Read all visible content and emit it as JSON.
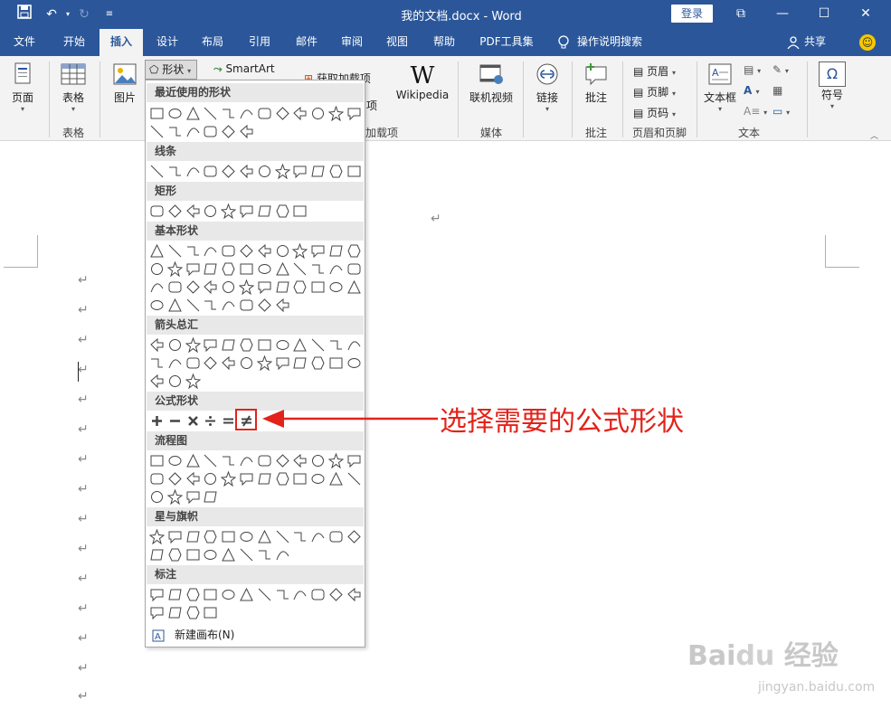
{
  "titlebar": {
    "title": "我的文档.docx  -  Word",
    "login": "登录",
    "bg": "#2b579a"
  },
  "tabs": [
    {
      "label": "文件",
      "active": false
    },
    {
      "label": "开始",
      "active": false
    },
    {
      "label": "插入",
      "active": true
    },
    {
      "label": "设计",
      "active": false
    },
    {
      "label": "布局",
      "active": false
    },
    {
      "label": "引用",
      "active": false
    },
    {
      "label": "邮件",
      "active": false
    },
    {
      "label": "审阅",
      "active": false
    },
    {
      "label": "视图",
      "active": false
    },
    {
      "label": "帮助",
      "active": false
    },
    {
      "label": "PDF工具集",
      "active": false
    }
  ],
  "tellme": "操作说明搜索",
  "share": "共享",
  "ribbon": {
    "page": "页面",
    "table": "表格",
    "table_group": "表格",
    "pictures": "图片",
    "shapes": "形状",
    "smartart": "SmartArt",
    "get_addins": "获取加载项",
    "addins_partial": "项",
    "addins_group_partial": "加载项",
    "wikipedia": "Wikipedia",
    "online_video": "联机视频",
    "media_group": "媒体",
    "link": "链接",
    "comment": "批注",
    "comment_group": "批注",
    "header": "页眉",
    "footer": "页脚",
    "page_number": "页码",
    "header_footer_group": "页眉和页脚",
    "textbox": "文本框",
    "text_group": "文本",
    "symbol": "符号"
  },
  "dropdown": {
    "sections": {
      "recent": "最近使用的形状",
      "lines": "线条",
      "rect": "矩形",
      "basic": "基本形状",
      "arrows": "箭头总汇",
      "equation": "公式形状",
      "flowchart": "流程图",
      "stars": "星与旗帜",
      "callouts": "标注"
    },
    "new_canvas": "新建画布(N)"
  },
  "annotation": "选择需要的公式形状",
  "watermark": {
    "logo": "Bai du 经验",
    "url": "jingyan.baidu.com"
  },
  "colors": {
    "accent": "#2b579a",
    "highlight": "#e2231a"
  }
}
